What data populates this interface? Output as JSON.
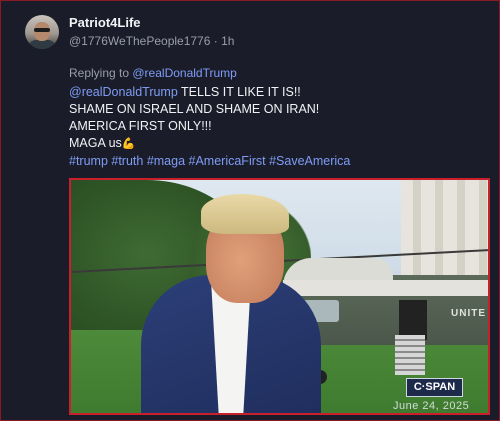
{
  "post": {
    "display_name": "Patriot4Life",
    "handle": "@1776WeThePeople1776",
    "separator": " · ",
    "time": "1h",
    "reply_prefix": "Replying to ",
    "reply_to": "@realDonaldTrump",
    "body": {
      "line1_mention": "@realDonaldTrump",
      "line1_text": " TELLS IT LIKE IT IS!!",
      "line2": "SHAME ON ISRAEL AND SHAME ON IRAN!",
      "line3": "AMERICA FIRST ONLY!!!",
      "line4": "MAGA us",
      "line4_icon": "flexed-biceps-icon",
      "hashtags": "#trump #truth #maga #AmericaFirst #SaveAmerica"
    }
  },
  "media": {
    "watermark": "C·SPAN",
    "date": "June 24, 2025",
    "helicopter_text": "UNITE"
  },
  "colors": {
    "background": "#1a1d29",
    "link": "#7f9cf5",
    "media_border": "#c9202c"
  }
}
